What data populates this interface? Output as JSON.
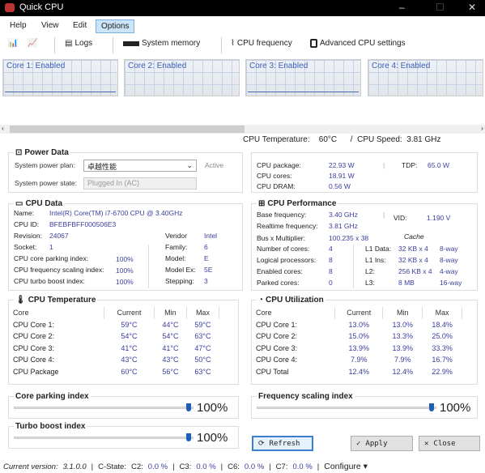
{
  "window": {
    "title": "Quick CPU",
    "minimize": "–",
    "maximize": "☐",
    "close": "✕"
  },
  "menu": [
    "Help",
    "View",
    "Edit",
    "Options"
  ],
  "toolbar": {
    "logs": "Logs",
    "system_memory": "System memory",
    "cpu_frequency": "CPU frequency",
    "advanced": "Advanced CPU settings"
  },
  "cores": [
    "Core 1: Enabled",
    "Core 2: Enabled",
    "Core 3: Enabled",
    "Core 4: Enabled"
  ],
  "summary": {
    "temp_label": "CPU Temperature:",
    "temp": "60°C",
    "sep": "/",
    "speed_label": "CPU Speed:",
    "speed": "3.81 GHz"
  },
  "power": {
    "title": "Power Data",
    "plan_label": "System power plan:",
    "plan": "卓越性能",
    "plan_status": "Active",
    "state_label": "System power state:",
    "state": "Plugged In (AC)",
    "package_label": "CPU package:",
    "package": "22.93 W",
    "cores_label": "CPU cores:",
    "cores": "18.91 W",
    "dram_label": "CPU DRAM:",
    "dram": "0.56 W",
    "tdp_label": "TDP:",
    "tdp": "65.0 W"
  },
  "cpu_data": {
    "title": "CPU Data",
    "name_label": "Name:",
    "name": "Intel(R) Core(TM) i7-6700 CPU @ 3.40GHz",
    "id_label": "CPU ID:",
    "id": "BFEBFBFF000506E3",
    "rev_label": "Revision:",
    "rev": "24067",
    "socket_label": "Socket:",
    "socket": "1",
    "parking_label": "CPU core parking index:",
    "parking": "100%",
    "freq_label": "CPU frequency scaling index:",
    "freq": "100%",
    "turbo_label": "CPU turbo boost index:",
    "turbo": "100%",
    "vendor_label": "Vendor",
    "vendor": "Intel",
    "family_label": "Family:",
    "family": "6",
    "model_label": "Model:",
    "model": "E",
    "modelex_label": "Model Ex:",
    "modelex": "5E",
    "stepping_label": "Stepping:",
    "stepping": "3"
  },
  "perf": {
    "title": "CPU Performance",
    "base_label": "Base frequency:",
    "base": "3.40 GHz",
    "vid_label": "VID:",
    "vid": "1.190 V",
    "rt_label": "Realtime frequency:",
    "rt": "3.81 GHz",
    "bus_label": "Bus x Multiplier:",
    "bus": "100.235 x 38",
    "cache": "Cache",
    "ncores_label": "Number of cores:",
    "ncores": "4",
    "logical_label": "Logical processors:",
    "logical": "8",
    "enabled_label": "Enabled cores:",
    "enabled": "8",
    "parked_label": "Parked cores:",
    "parked": "0",
    "l1d_label": "L1 Data:",
    "l1d": "32 KB x 4",
    "l1d_way": "8-way",
    "l1i_label": "L1 Ins:",
    "l1i": "32 KB x 4",
    "l1i_way": "8-way",
    "l2_label": "L2:",
    "l2": "256 KB x 4",
    "l2_way": "4-way",
    "l3_label": "L3:",
    "l3": "8 MB",
    "l3_way": "16-way"
  },
  "temp": {
    "title": "CPU Temperature",
    "headers": [
      "Core",
      "Current",
      "Min",
      "Max"
    ],
    "rows": [
      [
        "CPU Core 1:",
        "59°C",
        "44°C",
        "59°C"
      ],
      [
        "CPU Core 2:",
        "54°C",
        "54°C",
        "63°C"
      ],
      [
        "CPU Core 3:",
        "41°C",
        "41°C",
        "47°C"
      ],
      [
        "CPU Core 4:",
        "43°C",
        "43°C",
        "50°C"
      ],
      [
        "CPU Package",
        "60°C",
        "56°C",
        "63°C"
      ]
    ]
  },
  "util": {
    "title": "CPU Utilization",
    "headers": [
      "Core",
      "Current",
      "Min",
      "Max"
    ],
    "rows": [
      [
        "CPU Core 1:",
        "13.0%",
        "13.0%",
        "18.4%"
      ],
      [
        "CPU Core 2:",
        "15.0%",
        "13.3%",
        "25.0%"
      ],
      [
        "CPU Core 3:",
        "13.9%",
        "13.9%",
        "33.3%"
      ],
      [
        "CPU Core 4:",
        "7.9%",
        "7.9%",
        "16.7%"
      ],
      [
        "CPU Total",
        "12.4%",
        "12.4%",
        "22.9%"
      ]
    ]
  },
  "sliders": {
    "parking_title": "Core parking index",
    "parking": "100%",
    "turbo_title": "Turbo boost index",
    "turbo": "100%",
    "freq_title": "Frequency scaling index",
    "freq": "100%",
    "level_percent": 100
  },
  "buttons": {
    "refresh": "Refresh",
    "apply": "Apply",
    "close": "Close"
  },
  "status": {
    "version_label": "Current version:",
    "version": "3.1.0.0",
    "cstate": "C-State:",
    "c2_label": "C2:",
    "c2": "0.0 %",
    "c3_label": "C3:",
    "c3": "0.0 %",
    "c6_label": "C6:",
    "c6": "0.0 %",
    "c7_label": "C7:",
    "c7": "0.0 %",
    "configure": "Configure ▾"
  },
  "colors": {
    "accent": "#1d5fb8",
    "value": "#3b3f9e",
    "graph_line": "#4a66b0"
  }
}
